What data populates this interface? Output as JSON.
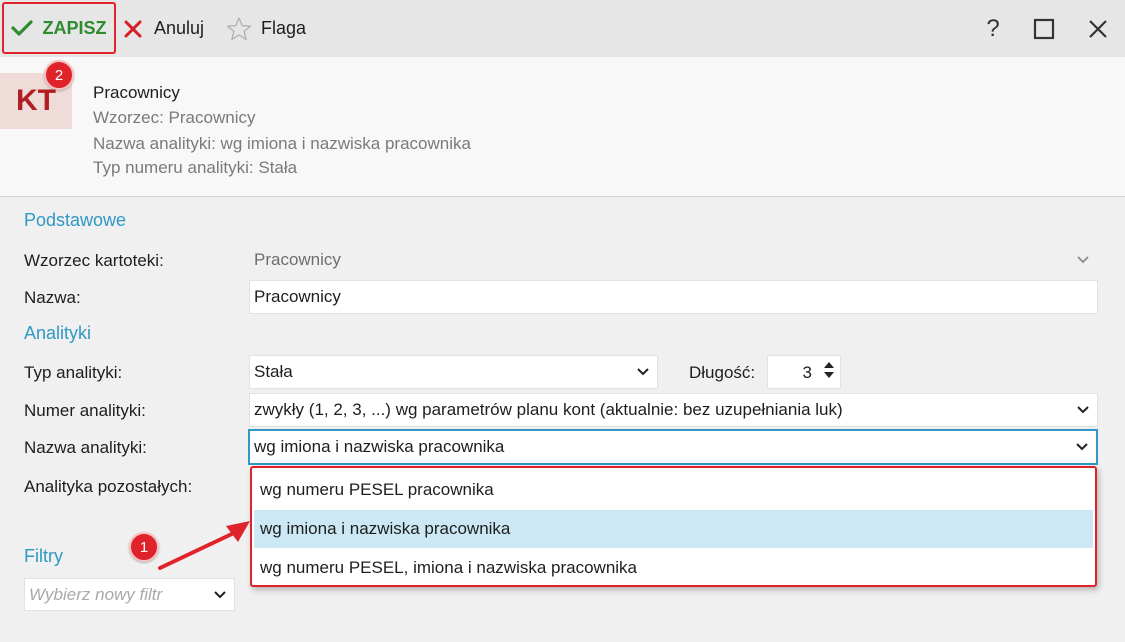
{
  "toolbar": {
    "save_label": "ZAPISZ",
    "cancel_label": "Anuluj",
    "flag_label": "Flaga"
  },
  "window_controls": {
    "help": "?"
  },
  "header": {
    "tile": "KT",
    "badge": "2",
    "title": "Pracownicy",
    "pattern": "Wzorzec: Pracownicy",
    "analytic_name": "Nazwa analityki: wg imiona i nazwiska pracownika",
    "analytic_number_type": "Typ numeru analityki: Stała"
  },
  "form": {
    "section_basic": "Podstawowe",
    "pattern_label": "Wzorzec kartoteki:",
    "pattern_value": "Pracownicy",
    "name_label": "Nazwa:",
    "name_value": "Pracownicy",
    "section_analytics": "Analityki",
    "type_label": "Typ analityki:",
    "type_value": "Stała",
    "length_label": "Długość:",
    "length_value": "3",
    "number_label": "Numer analityki:",
    "number_value": "zwykły (1, 2, 3, ...) wg parametrów planu kont (aktualnie: bez uzupełniania luk)",
    "analytic_name_label": "Nazwa analityki:",
    "analytic_name_value": "wg imiona i nazwiska pracownika",
    "others_label": "Analityka pozostałych:",
    "section_filters": "Filtry",
    "filter_placeholder": "Wybierz nowy filtr"
  },
  "dropdown": {
    "options": [
      "wg numeru PESEL pracownika",
      "wg imiona i nazwiska pracownika",
      "wg numeru PESEL, imiona i nazwiska pracownika"
    ],
    "selected_index": 1
  },
  "annotations": {
    "badge_1": "1"
  },
  "colors": {
    "accent": "#2f98c4",
    "highlight": "#e0232a",
    "save_green": "#2e8b2e",
    "selected_bg": "#cce8f4"
  }
}
